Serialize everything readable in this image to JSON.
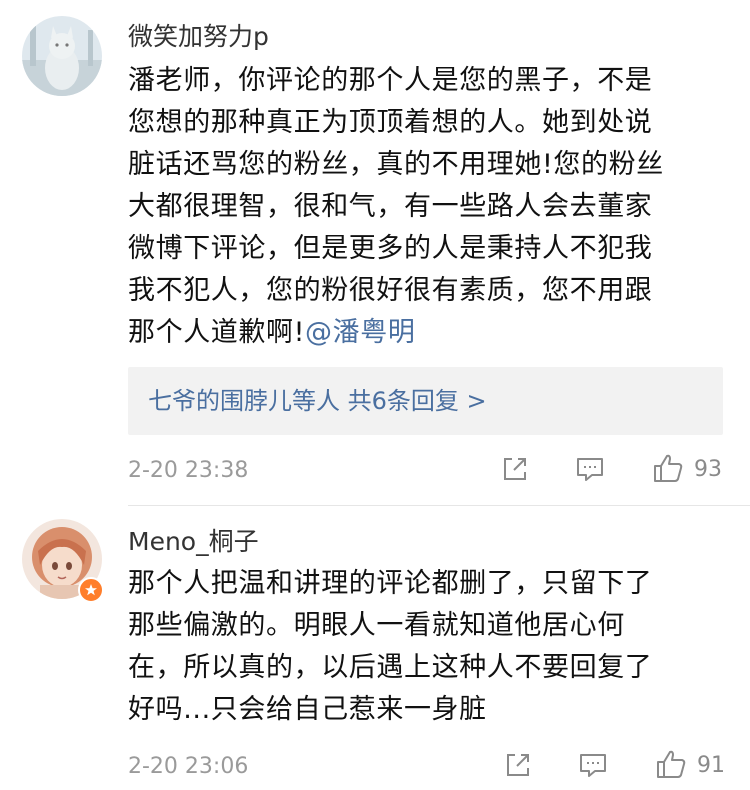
{
  "comments": [
    {
      "username": "微笑加努力p",
      "text_lines": [
        "潘老师，你评论的那个人是您的黑子，不是",
        "您想的那种真正为顶顶着想的人。她到处说",
        "脏话还骂您的粉丝，真的不用理她!您的粉丝",
        "大都很理智，很和气，有一些路人会去董家",
        "微博下评论，但是更多的人是秉持人不犯我",
        "我不犯人，您的粉很好很有素质，您不用跟",
        "那个人道歉啊!"
      ],
      "mention": "@潘粤明",
      "reply_summary": "七爷的围脖儿等人  共6条回复 >",
      "timestamp": "2-20 23:38",
      "like_count": "93"
    },
    {
      "username": "Meno_桐子",
      "text_lines": [
        "那个人把温和讲理的评论都删了，只留下了",
        "那些偏激的。明眼人一看就知道他居心何",
        "在，所以真的，以后遇上这种人不要回复了",
        "好吗...只会给自己惹来一身脏"
      ],
      "timestamp": "2-20 23:06",
      "like_count": "91"
    }
  ],
  "icons": {
    "share": "share-icon",
    "comment": "comment-icon",
    "like": "thumbs-up-icon",
    "vip": "vip-badge-icon"
  },
  "colors": {
    "mention": "#4a6fa0",
    "reply_text": "#4a6fa0",
    "reply_bg": "#f2f2f2",
    "timestamp": "#9a9a9a",
    "vip_badge": "#ff7e2b"
  }
}
